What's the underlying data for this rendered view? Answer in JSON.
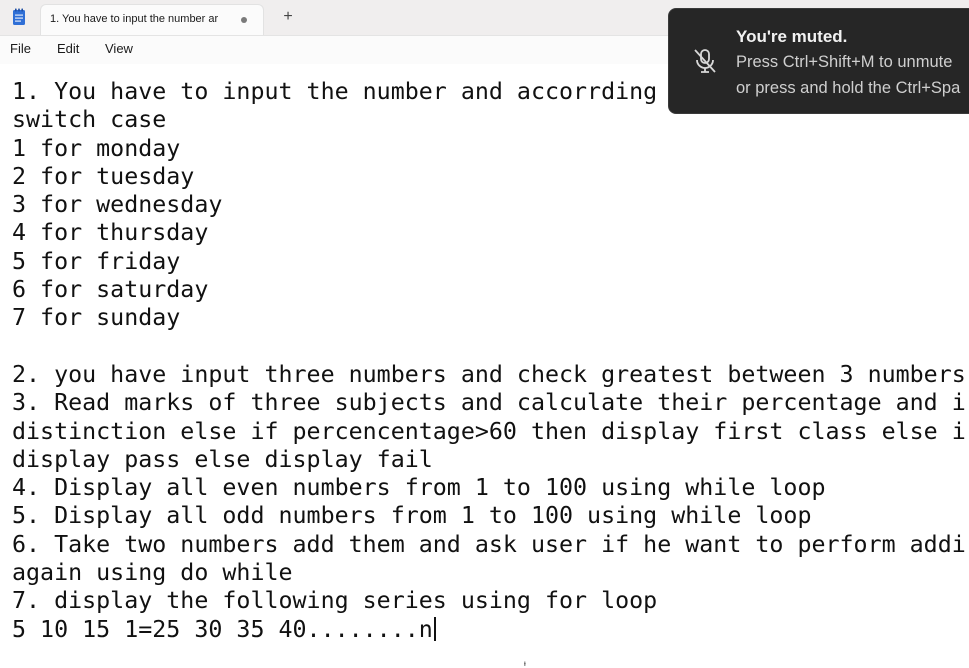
{
  "window": {
    "tab_title": "1. You have to input the number ar",
    "new_tab_glyph": "+"
  },
  "menu": {
    "file": "File",
    "edit": "Edit",
    "view": "View"
  },
  "editor": {
    "lines": [
      "1. You have to input the number and accorrding",
      "switch case",
      "1 for monday",
      "2 for tuesday",
      "3 for wednesday",
      "4 for thursday",
      "5 for friday",
      "6 for saturday",
      "7 for sunday",
      "",
      "2. you have input three numbers and check greatest between 3 numbers",
      "3. Read marks of three subjects and calculate their percentage and i",
      "distinction else if percencentage>60 then display first class else i",
      "display pass else display fail",
      "4. Display all even numbers from 1 to 100 using while loop",
      "5. Display all odd numbers from 1 to 100 using while loop",
      "6. Take two numbers add them and ask user if he want to perform addi",
      "again using do while",
      "7. display the following series using for loop",
      "5 10 15 1=25 30 35 40........n"
    ]
  },
  "toast": {
    "title": "You're muted.",
    "line1": "Press Ctrl+Shift+M to unmute",
    "line2": "or press and hold the Ctrl+Spa",
    "icon": "muted-microphone-icon"
  },
  "colors": {
    "tabbar_bg": "#f0eeee",
    "toast_bg": "#262626",
    "app_icon": "#2f6fd6"
  }
}
